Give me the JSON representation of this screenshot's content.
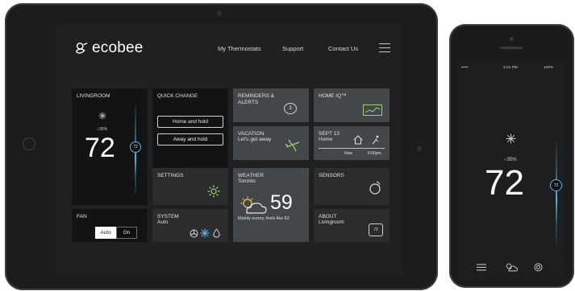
{
  "header": {
    "brand": "ecobee",
    "nav": [
      "My Thermostats",
      "Support",
      "Contact Us"
    ]
  },
  "tiles": {
    "livingroom": {
      "title": "LIVINGROOM",
      "humidity": "○35%",
      "temp": "72",
      "setpoint": "72"
    },
    "quick_change": {
      "title": "QUICK CHANGE",
      "home_hold": "Home and hold",
      "away_hold": "Away and hold"
    },
    "reminders": {
      "title": "REMINDERS &\nALERTS",
      "count": "3"
    },
    "home_iq": {
      "title": "HOME IQ™"
    },
    "vacation": {
      "title": "VACATION",
      "sub": "Let's get away"
    },
    "schedule": {
      "title": "SEPT 13",
      "sub": "Home",
      "time_from": "Now",
      "time_to": "6:00pm"
    },
    "settings": {
      "title": "SETTINGS"
    },
    "weather": {
      "title": "WEATHER",
      "city": "Toronto",
      "temp": "59",
      "desc": "Mainly sunny, feels like 62"
    },
    "sensors": {
      "title": "SENSORS"
    },
    "fan": {
      "title": "FAN",
      "auto": "Auto",
      "on": "On",
      "selected": "Auto"
    },
    "system": {
      "title": "SYSTEM",
      "mode": "Auto"
    },
    "about": {
      "title": "ABOUT",
      "sub": "Livingroom",
      "badge": "72"
    }
  },
  "phone": {
    "carrier": "•••••",
    "time": "4:21 PM",
    "battery": "100%",
    "humidity": "○35%",
    "temp": "72",
    "setpoint": "72"
  },
  "colors": {
    "accent": "#5fb3e0",
    "tile_dark": "#121314",
    "tile_light": "#444749",
    "leaf": "#9ad17a"
  }
}
